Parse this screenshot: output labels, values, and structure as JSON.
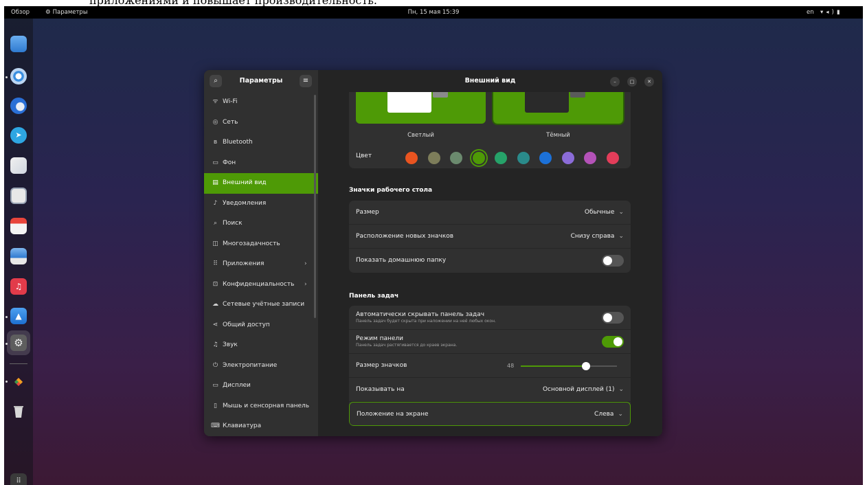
{
  "caption_fragment": "приложениями и повышает производительность.",
  "topbar": {
    "overview": "Обзор",
    "app_name": "Параметры",
    "clock": "Пн, 15 мая  15:39",
    "lang": "en",
    "tray_icons": [
      "wifi-icon",
      "volume-icon",
      "battery-icon"
    ]
  },
  "dock": {
    "items": [
      "files-icon",
      "chromium-icon",
      "thunderbird-icon",
      "telegram-icon",
      "app-icon",
      "text-editor-icon",
      "calendar-icon",
      "image-viewer-icon",
      "music-icon",
      "software-icon",
      "settings-icon",
      "anydesk-icon",
      "trash-icon",
      "app-grid-icon"
    ]
  },
  "sidebar": {
    "title": "Параметры",
    "items": [
      {
        "label": "Wi-Fi",
        "icon": "wifi-icon"
      },
      {
        "label": "Сеть",
        "icon": "network-icon"
      },
      {
        "label": "Bluetooth",
        "icon": "bluetooth-icon"
      },
      {
        "label": "Фон",
        "icon": "background-icon"
      },
      {
        "label": "Внешний вид",
        "icon": "appearance-icon"
      },
      {
        "label": "Уведомления",
        "icon": "bell-icon"
      },
      {
        "label": "Поиск",
        "icon": "search-icon"
      },
      {
        "label": "Многозадачность",
        "icon": "multitasking-icon"
      },
      {
        "label": "Приложения",
        "icon": "apps-icon"
      },
      {
        "label": "Конфиденциальность",
        "icon": "lock-icon"
      },
      {
        "label": "Сетевые учётные записи",
        "icon": "cloud-icon"
      },
      {
        "label": "Общий доступ",
        "icon": "share-icon"
      },
      {
        "label": "Звук",
        "icon": "music-note-icon"
      },
      {
        "label": "Электропитание",
        "icon": "power-icon"
      },
      {
        "label": "Дисплеи",
        "icon": "display-icon"
      },
      {
        "label": "Мышь и сенсорная панель",
        "icon": "mouse-icon"
      },
      {
        "label": "Клавиатура",
        "icon": "keyboard-icon"
      }
    ]
  },
  "main": {
    "title": "Внешний вид",
    "style": {
      "light_label": "Светлый",
      "dark_label": "Тёмный"
    },
    "color": {
      "label": "Цвет",
      "swatches": [
        "#e95420",
        "#7d7d5a",
        "#6b8a6e",
        "#4e9a06",
        "#26a269",
        "#2a8a8a",
        "#1c71d8",
        "#8b6cd8",
        "#b452b8",
        "#e33d5a"
      ],
      "selected_index": 3
    },
    "desktop_icons": {
      "section_title": "Значки рабочего стола",
      "size_label": "Размер",
      "size_value": "Обычные",
      "position_label": "Расположение новых значков",
      "position_value": "Снизу справа",
      "home_label": "Показать домашнюю папку",
      "home_on": false
    },
    "dock": {
      "section_title": "Панель задач",
      "autohide_label": "Автоматически скрывать панель задач",
      "autohide_sub": "Панель задач будет скрыта при наложении на неё любых окон.",
      "autohide_on": false,
      "panel_mode_label": "Режим панели",
      "panel_mode_sub": "Панель задач растягивается до краев экрана.",
      "panel_mode_on": true,
      "icon_size_label": "Размер значков",
      "icon_size_value": "48",
      "icon_size_fraction": 0.68,
      "show_on_label": "Показывать на",
      "show_on_value": "Основной дисплей (1)",
      "position_label": "Положение на экране",
      "position_value": "Слева"
    }
  },
  "colors": {
    "accent": "#4e9a06",
    "window_bg": "#242424",
    "sidebar_bg": "#303030"
  }
}
